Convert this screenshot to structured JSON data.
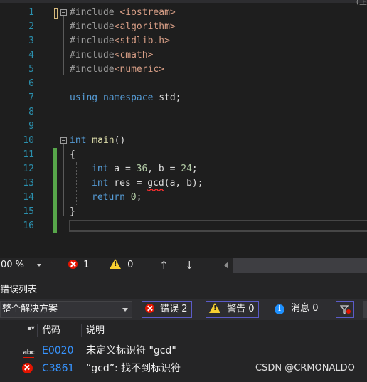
{
  "editor": {
    "lines": [
      {
        "n": "1",
        "code": "#include <iostream>"
      },
      {
        "n": "2",
        "code": "#include<algorithm>"
      },
      {
        "n": "3",
        "code": "#include<stdlib.h>"
      },
      {
        "n": "4",
        "code": "#include<cmath>"
      },
      {
        "n": "5",
        "code": "#include<numeric>"
      },
      {
        "n": "6",
        "code": ""
      },
      {
        "n": "7",
        "code": "using namespace std;"
      },
      {
        "n": "8",
        "code": ""
      },
      {
        "n": "9",
        "code": ""
      },
      {
        "n": "10",
        "code": "int main()"
      },
      {
        "n": "11",
        "code": "{"
      },
      {
        "n": "12",
        "code": "int a = 36, b = 24;"
      },
      {
        "n": "13",
        "code": "int res = gcd(a, b);"
      },
      {
        "n": "14",
        "code": "return 0;"
      },
      {
        "n": "15",
        "code": "}"
      },
      {
        "n": "16",
        "code": ""
      }
    ],
    "tokens": {
      "include_kw": "#include",
      "iostream": " <iostream>",
      "algorithm": "<algorithm>",
      "stdlib": "<stdlib.h>",
      "cmath": "<cmath>",
      "numeric": "<numeric>",
      "using": "using",
      "namespace": "namespace",
      "std": " std;",
      "int": "int",
      "main": "main",
      "main_parens": "()",
      "open_brace": "{",
      "close_brace": "}",
      "decl_ab": " a = ",
      "n36": "36",
      "comma_b": ", b = ",
      "n24": "24",
      "semi": ";",
      "res": " res = ",
      "gcd": "gcd",
      "gcd_args": "(a, b);",
      "return": "return",
      "zero": "0",
      "return_end": ";"
    }
  },
  "statusbar": {
    "zoom": "00 %",
    "errors": "1",
    "warnings": "0",
    "up_arrow": "↑",
    "down_arrow": "↓"
  },
  "error_list": {
    "title": "错误列表",
    "scope": "整个解决方案",
    "errors_btn": "错误 2",
    "warnings_btn": "警告 0",
    "messages_btn": "消息 0",
    "columns": {
      "code": "代码",
      "description": "说明"
    },
    "rows": [
      {
        "icon": "abc-spell-icon",
        "code": "E0020",
        "description": "未定义标识符 \"gcd\""
      },
      {
        "icon": "error-icon",
        "code": "C3861",
        "description": "“gcd”: 找不到标识符"
      }
    ]
  },
  "watermark": "CSDN @CRMONALDO",
  "top_corner": "(正"
}
